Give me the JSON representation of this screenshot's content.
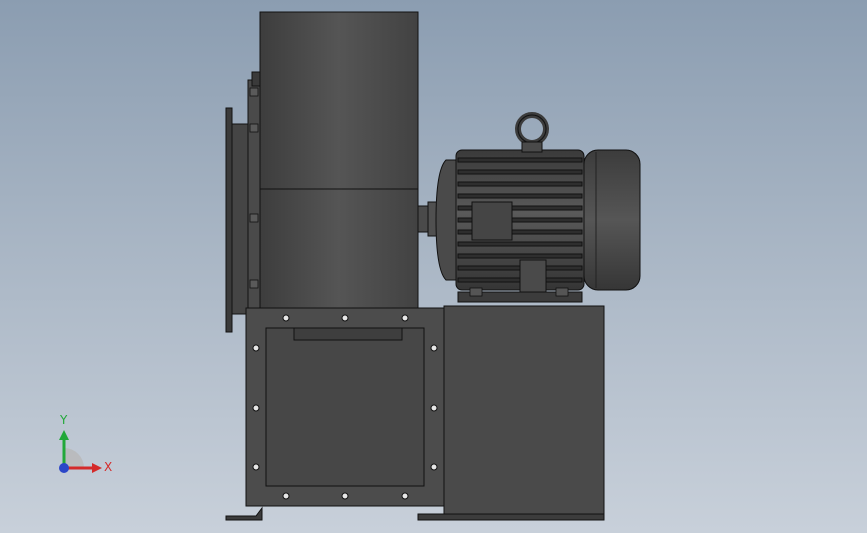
{
  "viewport": {
    "background_top": "#8b9db1",
    "background_bottom": "#c8d0da"
  },
  "model": {
    "body_color": "#4a4a4a",
    "body_dark": "#333333",
    "edge_color": "#111111",
    "hole_color": "#e6e6e6"
  },
  "triad": {
    "x_label": "X",
    "y_label": "Y",
    "x_color": "#d42a2a",
    "y_color": "#22a83a",
    "z_color": "#2b46c8"
  }
}
